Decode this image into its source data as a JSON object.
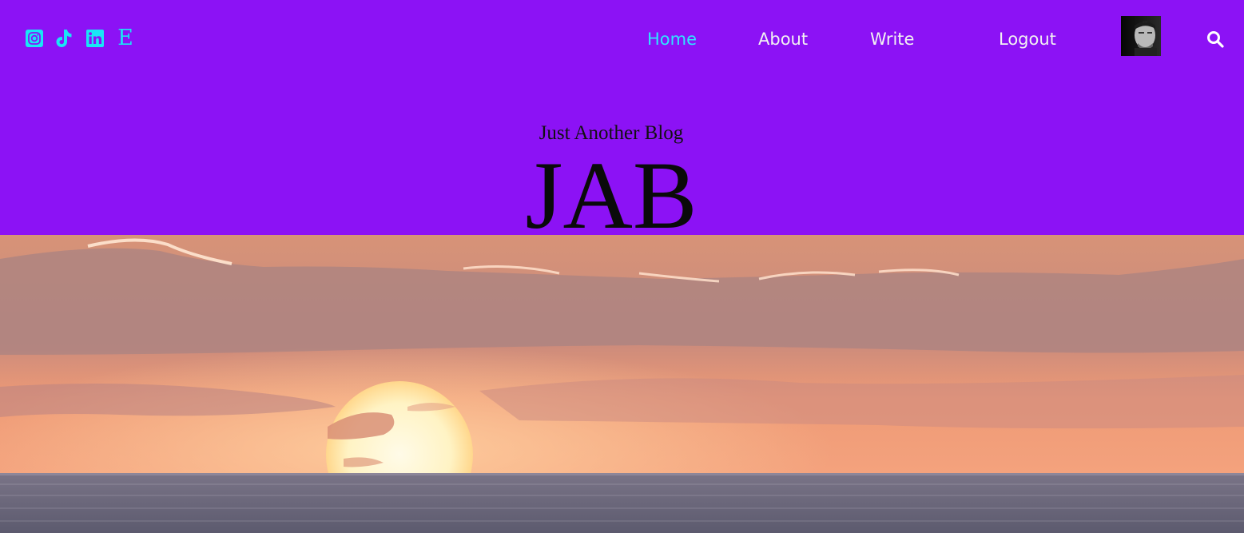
{
  "header": {
    "socials": [
      {
        "name": "instagram-icon"
      },
      {
        "name": "tiktok-icon"
      },
      {
        "name": "linkedin-icon"
      },
      {
        "name": "etsy-icon",
        "glyph": "E"
      }
    ],
    "nav": {
      "home": "Home",
      "about": "About",
      "write": "Write",
      "logout": "Logout"
    },
    "avatar_icon": "user-avatar",
    "search_icon": "search-icon"
  },
  "site": {
    "tagline": "Just Another Blog",
    "title": "JAB"
  },
  "colors": {
    "background": "#8c12f5",
    "accent": "#2ee6ff",
    "nav_text": "#f2f2f2",
    "title_text": "#0a0a0a"
  }
}
